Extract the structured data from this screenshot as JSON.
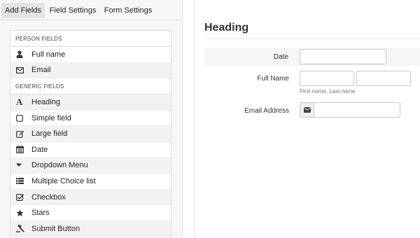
{
  "tabs": [
    {
      "label": "Add Fields",
      "active": true
    },
    {
      "label": "Field Settings",
      "active": false
    },
    {
      "label": "Form Settings",
      "active": false
    }
  ],
  "person_group": "PERSON FIELDS",
  "person_fields": [
    {
      "label": "Full name",
      "icon": "user-icon"
    },
    {
      "label": "Email",
      "icon": "envelope-icon"
    }
  ],
  "generic_group": "GENERIC FIELDS",
  "generic_fields": [
    {
      "label": "Heading",
      "icon": "heading-icon"
    },
    {
      "label": "Simple field",
      "icon": "square-icon"
    },
    {
      "label": "Large field",
      "icon": "edit-icon"
    },
    {
      "label": "Date",
      "icon": "calendar-icon"
    },
    {
      "label": "Dropdown Menu",
      "icon": "caret-down-icon"
    },
    {
      "label": "Multiple Choice list",
      "icon": "list-icon"
    },
    {
      "label": "Checkbox",
      "icon": "check-square-icon"
    },
    {
      "label": "Stars",
      "icon": "star-icon"
    },
    {
      "label": "Submit Button",
      "icon": "gavel-icon"
    }
  ],
  "form": {
    "heading": "Heading",
    "date_label": "Date",
    "fullname_label": "Full Name",
    "fullname_hint": "First name, Last name",
    "email_label": "Email Address",
    "email_icon": "envelope-icon"
  }
}
